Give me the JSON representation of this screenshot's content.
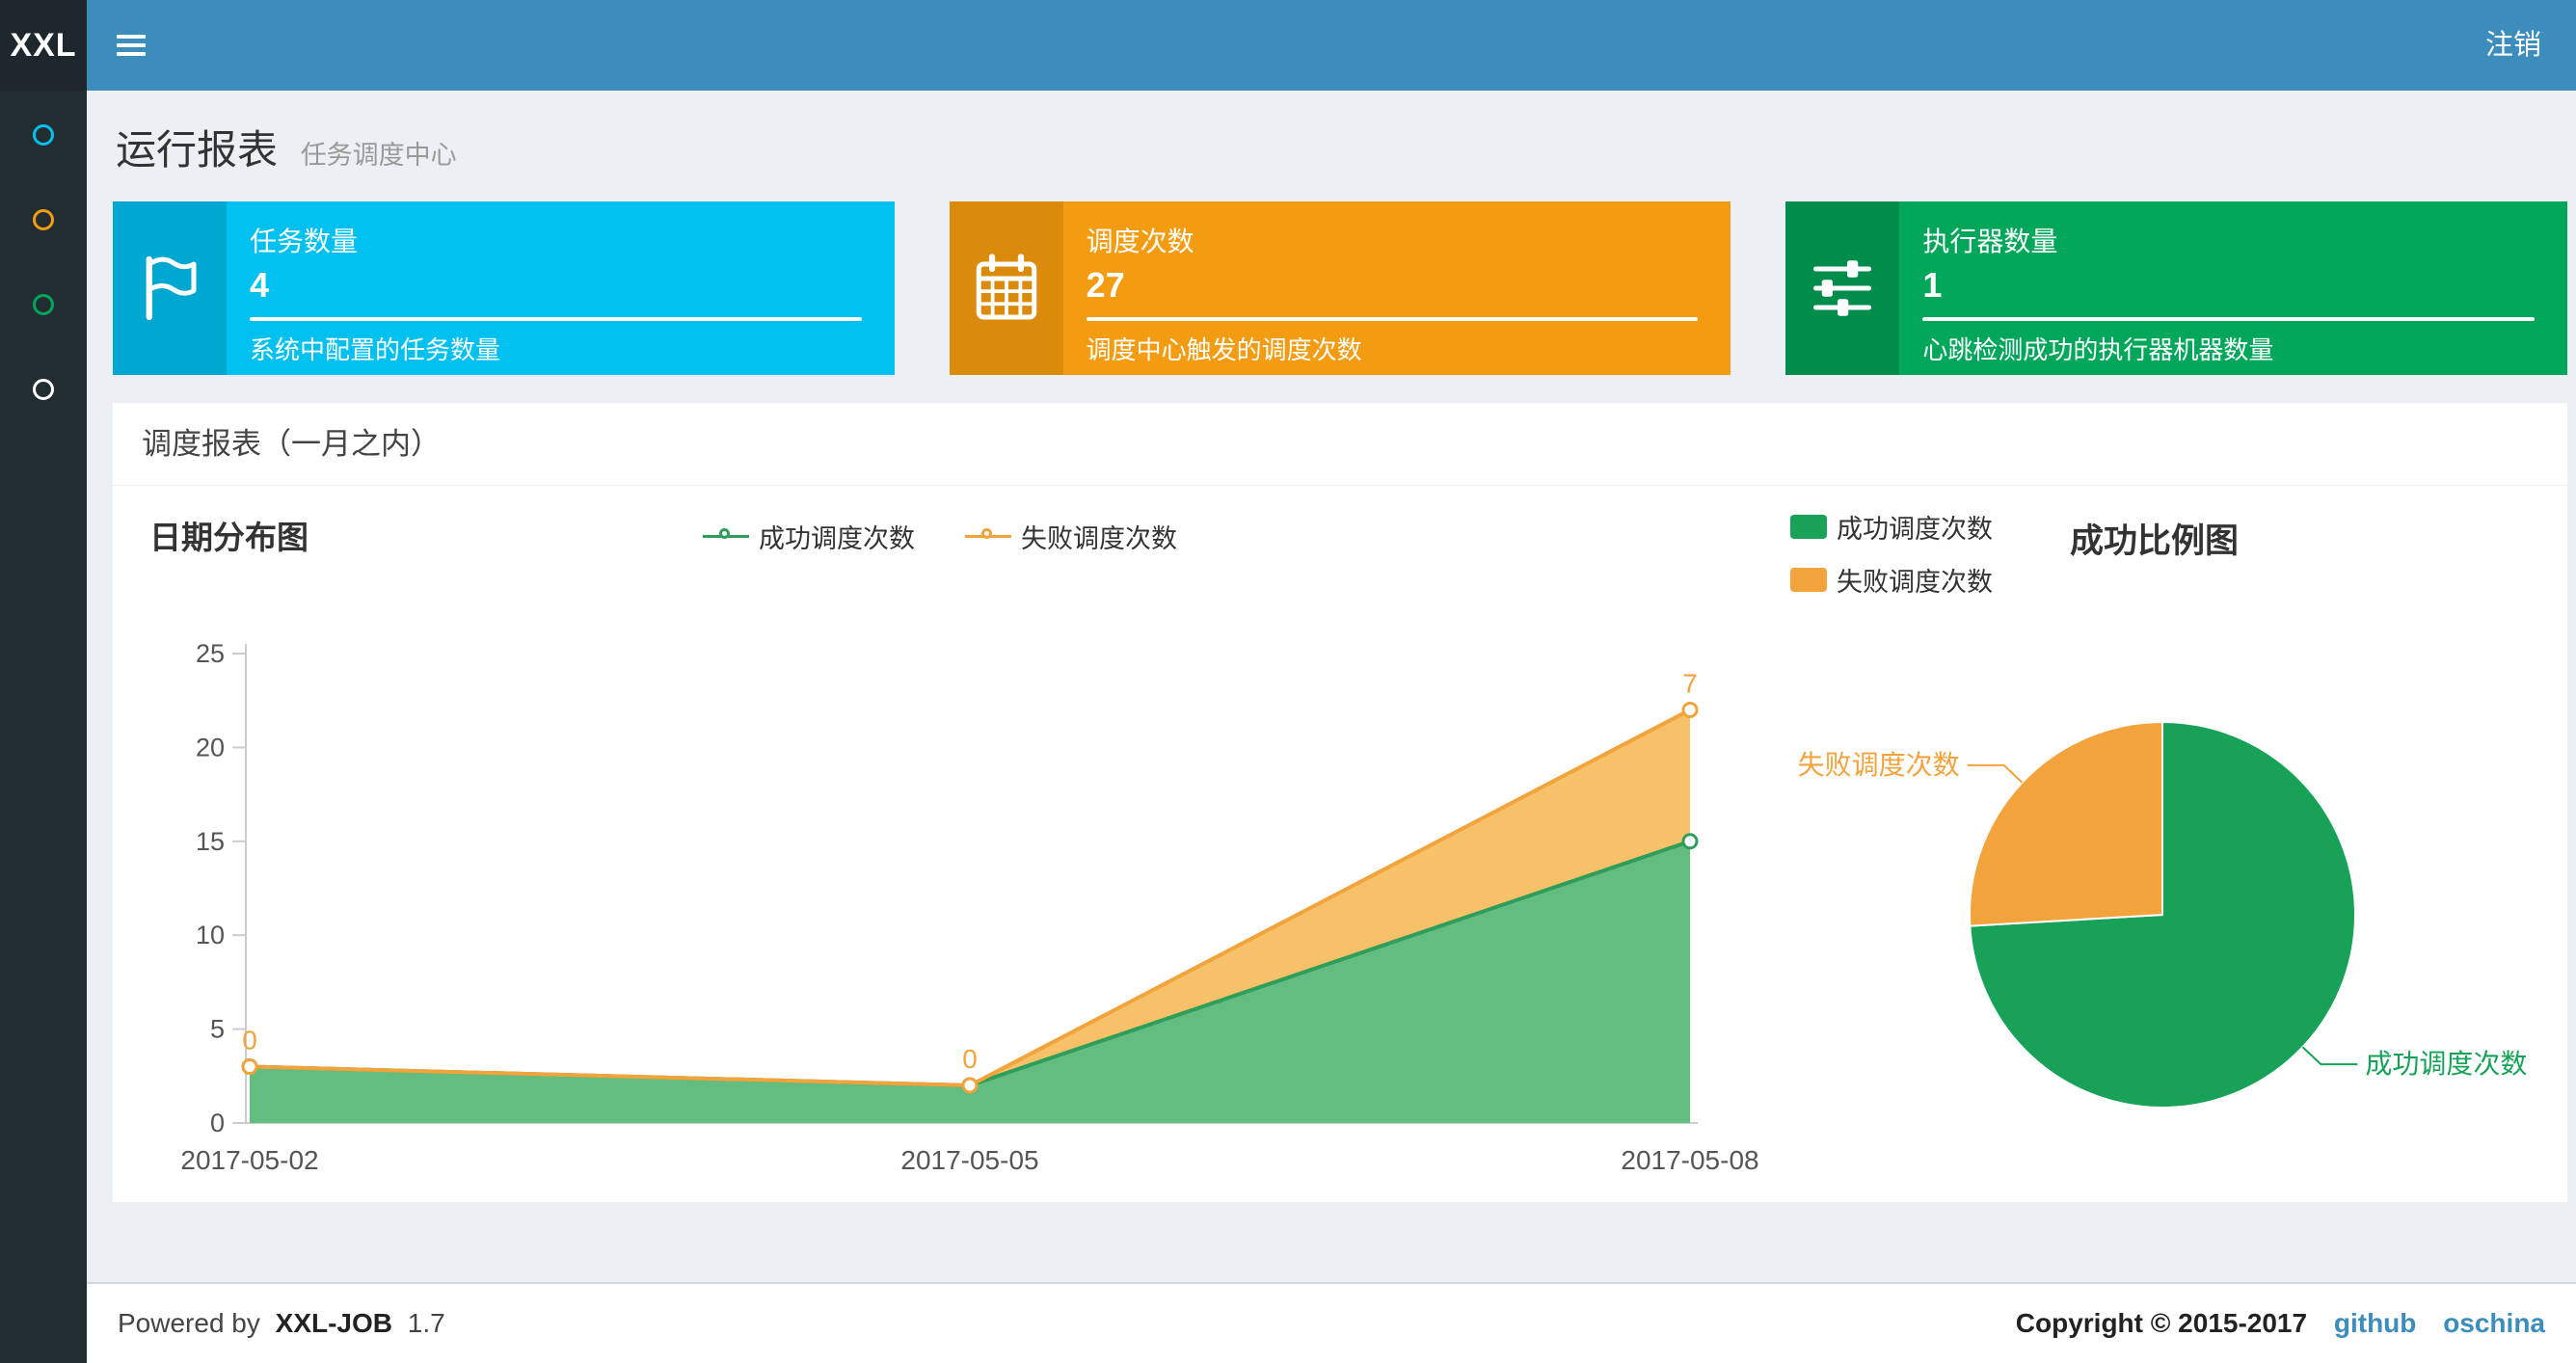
{
  "navbar": {
    "logo": "XXL",
    "logout_label": "注销"
  },
  "sidebar": {
    "items": [
      {
        "id": "menu-1",
        "icon_color": "#00c0ef"
      },
      {
        "id": "menu-2",
        "icon_color": "#f39c12"
      },
      {
        "id": "menu-3",
        "icon_color": "#00a65a"
      },
      {
        "id": "menu-4",
        "icon_color": "#ffffff"
      }
    ]
  },
  "page": {
    "title": "运行报表",
    "subtitle": "任务调度中心"
  },
  "info_boxes": [
    {
      "title": "任务数量",
      "number": "4",
      "description": "系统中配置的任务数量",
      "bg": "#00c0ef",
      "icon_bg": "#00a7d0",
      "icon": "flag-icon"
    },
    {
      "title": "调度次数",
      "number": "27",
      "description": "调度中心触发的调度次数",
      "bg": "#f39c12",
      "icon_bg": "#db8b0b",
      "icon": "calendar-icon"
    },
    {
      "title": "执行器数量",
      "number": "1",
      "description": "心跳检测成功的执行器机器数量",
      "bg": "#00a65a",
      "icon_bg": "#008d4c",
      "icon": "sliders-icon"
    }
  ],
  "panel": {
    "title": "调度报表（一月之内）"
  },
  "chart_data": [
    {
      "type": "area",
      "title": "日期分布图",
      "x": [
        "2017-05-02",
        "2017-05-05",
        "2017-05-08"
      ],
      "stacked": true,
      "grid": false,
      "legend_position": "top-center",
      "series": [
        {
          "name": "成功调度次数",
          "values": [
            3,
            2,
            15
          ],
          "color": "#2f9e5a",
          "fill": "#64bd80"
        },
        {
          "name": "失败调度次数",
          "values": [
            0,
            0,
            7
          ],
          "color": "#f2a33c",
          "fill": "#f6c169",
          "point_labels": [
            "0",
            "0",
            "7"
          ]
        }
      ],
      "ylim": [
        0,
        25
      ],
      "yticks": [
        0,
        5,
        10,
        15,
        20,
        25
      ]
    },
    {
      "type": "pie",
      "title": "成功比例图",
      "start_angle_deg": 90,
      "clockwise": true,
      "legend_position": "top-left",
      "slices": [
        {
          "name": "成功调度次数",
          "value": 20,
          "color": "#17a258"
        },
        {
          "name": "失败调度次数",
          "value": 7,
          "color": "#f2a33c"
        }
      ]
    }
  ],
  "footer": {
    "powered_by": "Powered by",
    "product": "XXL-JOB",
    "version": "1.7",
    "copyright": "Copyright © 2015-2017",
    "links": [
      {
        "label": "github"
      },
      {
        "label": "oschina"
      }
    ]
  }
}
